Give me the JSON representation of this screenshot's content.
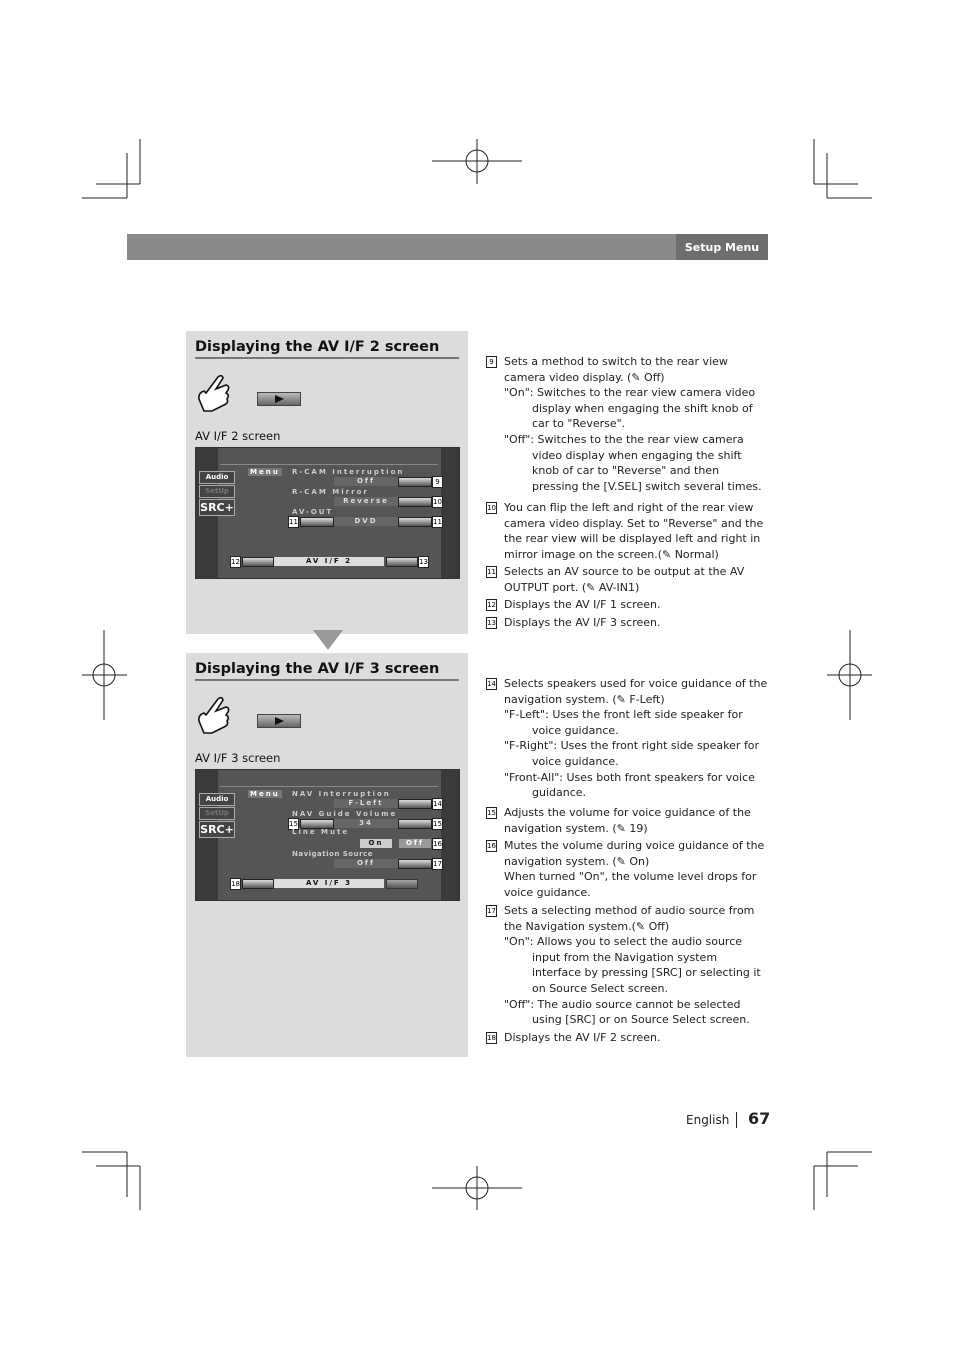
{
  "header": {
    "section": "Setup Menu"
  },
  "panel1": {
    "title": "Displaying the AV I/F 2 screen",
    "caption": "AV I/F 2 screen",
    "screen": {
      "side": [
        "Audio",
        "SetUp",
        "SRC+"
      ],
      "menu": "Menu",
      "labels": [
        "R-CAM Interruption",
        "R-CAM Mirror",
        "AV-OUT"
      ],
      "values": [
        "Off",
        "Reverse",
        "DVD"
      ],
      "footer": "AV I/F 2",
      "nums": [
        "9",
        "10",
        "11",
        "11",
        "12",
        "13"
      ]
    }
  },
  "panel2": {
    "title": "Displaying the AV I/F 3 screen",
    "caption": "AV I/F 3 screen",
    "screen": {
      "side": [
        "Audio",
        "SetUp",
        "SRC+"
      ],
      "menu": "Menu",
      "labels": [
        "NAV Interruption",
        "NAV Guide Volume",
        "Line Mute",
        "Navigation Source"
      ],
      "values": [
        "F-Left",
        "34",
        "On",
        "Off",
        "Off"
      ],
      "footer": "AV I/F 3",
      "nums": [
        "14",
        "15",
        "15",
        "16",
        "17",
        "18"
      ]
    }
  },
  "items1": [
    {
      "n": "9",
      "lines": [
        "Sets a method to switch to the rear view camera video display. (✎ Off)",
        "\"On\": Switches to the rear view camera video display when engaging  the shift knob of car to \"Reverse\".",
        "\"Off\": Switches to the the rear view camera video display when engaging  the shift knob of car to \"Reverse\" and then pressing the [V.SEL] switch several times."
      ]
    },
    {
      "n": "10",
      "lines": [
        "You can flip the left and right of the rear view camera video display. Set to  \"Reverse\" and the the rear view will be displayed left and right in mirror image on the screen.(✎ Normal)"
      ]
    },
    {
      "n": "11",
      "lines": [
        "Selects an AV source to be output at the AV OUTPUT port. (✎ AV-IN1)"
      ]
    },
    {
      "n": "12",
      "lines": [
        "Displays the AV I/F 1 screen."
      ]
    },
    {
      "n": "13",
      "lines": [
        "Displays the AV I/F 3 screen."
      ]
    }
  ],
  "items2": [
    {
      "n": "14",
      "lines": [
        "Selects speakers used for voice guidance of the navigation system. (✎ F-Left)",
        "\"F-Left\":    Uses the front left side speaker for voice guidance.",
        "\"F-Right\":   Uses the front right side speaker for voice guidance.",
        "\"Front-All\": Uses both front speakers for voice guidance."
      ]
    },
    {
      "n": "15",
      "lines": [
        "Adjusts the volume for voice guidance of the navigation system. (✎ 19)"
      ]
    },
    {
      "n": "16",
      "lines": [
        "Mutes the volume during voice guidance of the navigation system. (✎ On)",
        "When turned \"On\", the volume level drops for voice guidance."
      ]
    },
    {
      "n": "17",
      "lines": [
        "Sets a selecting method of audio source from the Navigation system.(✎ Off)",
        "\"On\": Allows you to select the audio source input from the Navigation system interface by pressing [SRC] or selecting it on Source Select screen.",
        "\"Off\": The audio source cannot be selected using [SRC] or on Source Select screen."
      ]
    },
    {
      "n": "18",
      "lines": [
        "Displays the AV I/F 2 screen."
      ]
    }
  ],
  "footer": {
    "language": "English",
    "page": "67"
  }
}
